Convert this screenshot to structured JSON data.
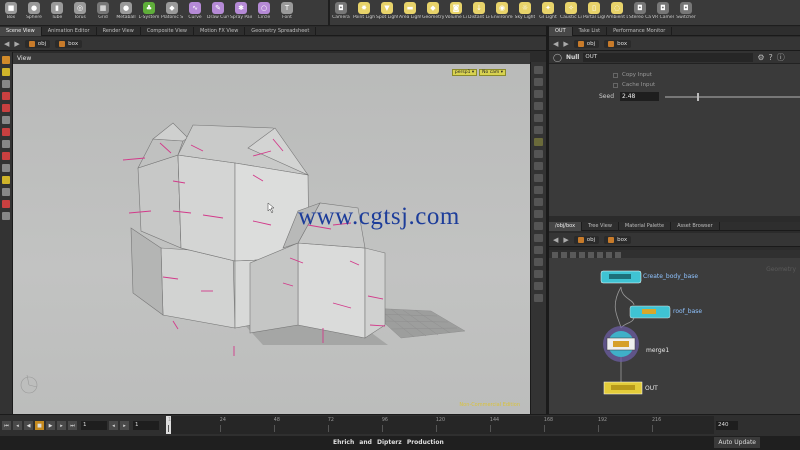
{
  "shelf_left": [
    {
      "label": "Box",
      "color": "#9a9a9a",
      "glyph": "■"
    },
    {
      "label": "Sphere",
      "color": "#9a9a9a",
      "glyph": "●"
    },
    {
      "label": "Tube",
      "color": "#9a9a9a",
      "glyph": "▮"
    },
    {
      "label": "Torus",
      "color": "#9a9a9a",
      "glyph": "◎"
    },
    {
      "label": "Grid",
      "color": "#777777",
      "glyph": "▦"
    },
    {
      "label": "Metaball",
      "color": "#9a9a9a",
      "glyph": "●"
    },
    {
      "label": "L-System",
      "color": "#5fae3a",
      "glyph": "♣"
    },
    {
      "label": "Platonic Sol...",
      "color": "#9a9a9a",
      "glyph": "◆"
    },
    {
      "label": "Curve",
      "color": "#b58ad6",
      "glyph": "∿"
    },
    {
      "label": "Draw Curve",
      "color": "#b58ad6",
      "glyph": "✎"
    },
    {
      "label": "Spray Paint",
      "color": "#b58ad6",
      "glyph": "✱"
    },
    {
      "label": "Circle",
      "color": "#b58ad6",
      "glyph": "○"
    },
    {
      "label": "Font",
      "color": "#9a9a9a",
      "glyph": "T"
    }
  ],
  "shelf_right": [
    {
      "label": "Camera",
      "color": "#777777",
      "glyph": "◘"
    },
    {
      "label": "Point Light",
      "color": "#e8d36a",
      "glyph": "✸"
    },
    {
      "label": "Spot Light",
      "color": "#e8d36a",
      "glyph": "▼"
    },
    {
      "label": "Area Light",
      "color": "#e8d36a",
      "glyph": "▬"
    },
    {
      "label": "Geometry L...",
      "color": "#e8d36a",
      "glyph": "◆"
    },
    {
      "label": "Volume Light",
      "color": "#e8d36a",
      "glyph": "◙"
    },
    {
      "label": "Distant Light",
      "color": "#e8d36a",
      "glyph": "↓"
    },
    {
      "label": "Environmen...",
      "color": "#e8d36a",
      "glyph": "◉"
    },
    {
      "label": "Sky Light",
      "color": "#e8d36a",
      "glyph": "☼"
    },
    {
      "label": "GI Light",
      "color": "#e8d36a",
      "glyph": "✦"
    },
    {
      "label": "Caustic Light",
      "color": "#e8d36a",
      "glyph": "✧"
    },
    {
      "label": "Portal Light",
      "color": "#e8d36a",
      "glyph": "▯"
    },
    {
      "label": "Ambient Lig...",
      "color": "#e8d36a",
      "glyph": "◌"
    },
    {
      "label": "Stereo Cam...",
      "color": "#777777",
      "glyph": "◘"
    },
    {
      "label": "VR Camera",
      "color": "#777777",
      "glyph": "◘"
    },
    {
      "label": "Switcher",
      "color": "#777777",
      "glyph": "◘"
    }
  ],
  "left_tabs": [
    "Scene View",
    "Animation Editor",
    "Render View",
    "Composite View",
    "Motion FX View",
    "Geometry Spreadsheet"
  ],
  "right_top_tabs": [
    "OUT",
    "Take List",
    "Performance Monitor"
  ],
  "right_bottom_tabs": [
    "/obj/box",
    "Tree View",
    "Material Palette",
    "Asset Browser"
  ],
  "path": {
    "root": "obj",
    "node": "box"
  },
  "viewport": {
    "title": "View",
    "persp_labels": [
      "persp1 ▾",
      "No cam ▾"
    ],
    "watermark": "www.cgtsj.com",
    "nce": "Non-Commercial Edition"
  },
  "params": {
    "node_type": "Null",
    "node_name": "OUT",
    "copy_input": "Copy Input",
    "cache_input": "Cache Input",
    "seed_label": "Seed",
    "seed_value": "2.48"
  },
  "network": {
    "nodes": [
      "Create_body_base",
      "roof_base",
      "merge1",
      "OUT"
    ],
    "corner_label": "Geometry"
  },
  "timeline": {
    "current_frame": "1",
    "start_frame": "1",
    "end_frame": "240",
    "ticks": [
      "1",
      "24",
      "48",
      "72",
      "96",
      "120",
      "144",
      "168",
      "192",
      "216"
    ]
  },
  "status": {
    "production": "Ehrich and Dipterz Production",
    "auto_update": "Auto Update"
  }
}
